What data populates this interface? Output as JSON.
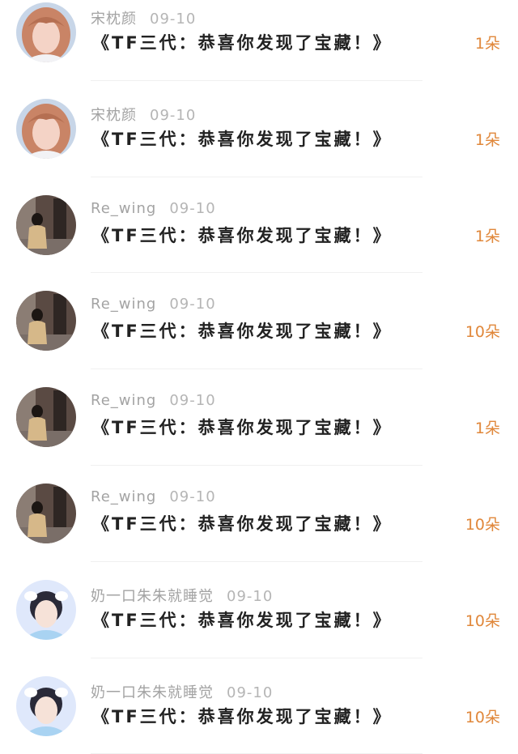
{
  "rows": [
    {
      "name": "宋枕颜",
      "date": "09-10",
      "message": "《TF三代：恭喜你发现了宝藏！》",
      "gift": "1朵",
      "avatar_icon": "girl-pink-avatar-icon"
    },
    {
      "name": "宋枕颜",
      "date": "09-10",
      "message": "《TF三代：恭喜你发现了宝藏！》",
      "gift": "1朵",
      "avatar_icon": "girl-pink-avatar-icon"
    },
    {
      "name": "Re_wing",
      "date": "09-10",
      "message": "《TF三代：恭喜你发现了宝藏！》",
      "gift": "1朵",
      "avatar_icon": "street-photo-avatar-icon"
    },
    {
      "name": "Re_wing",
      "date": "09-10",
      "message": "《TF三代：恭喜你发现了宝藏！》",
      "gift": "10朵",
      "avatar_icon": "street-photo-avatar-icon"
    },
    {
      "name": "Re_wing",
      "date": "09-10",
      "message": "《TF三代：恭喜你发现了宝藏！》",
      "gift": "1朵",
      "avatar_icon": "street-photo-avatar-icon"
    },
    {
      "name": "Re_wing",
      "date": "09-10",
      "message": "《TF三代：恭喜你发现了宝藏！》",
      "gift": "10朵",
      "avatar_icon": "street-photo-avatar-icon"
    },
    {
      "name": "奶一口朱朱就睡觉",
      "date": "09-10",
      "message": "《TF三代：恭喜你发现了宝藏！》",
      "gift": "10朵",
      "avatar_icon": "boy-blue-avatar-icon"
    },
    {
      "name": "奶一口朱朱就睡觉",
      "date": "09-10",
      "message": "《TF三代：恭喜你发现了宝藏！》",
      "gift": "10朵",
      "avatar_icon": "boy-blue-avatar-icon"
    }
  ],
  "colors": {
    "name": "#a3a3a3",
    "message": "#222222",
    "gift": "#e0873a"
  }
}
